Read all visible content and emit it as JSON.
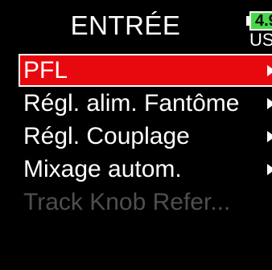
{
  "header": {
    "title": "ENTRÉE",
    "battery": {
      "level": "4.9",
      "source": "USB",
      "color": "#49d64b"
    }
  },
  "menu": {
    "items": [
      {
        "label": "PFL",
        "selected": true,
        "enabled": true,
        "icon": "chevron-right-icon"
      },
      {
        "label": "Régl. alim. Fantôme",
        "selected": false,
        "enabled": true,
        "icon": "chevron-right-icon"
      },
      {
        "label": "Régl. Couplage",
        "selected": false,
        "enabled": true,
        "icon": "chevron-right-icon"
      },
      {
        "label": "Mixage autom.",
        "selected": false,
        "enabled": true,
        "icon": "chevron-right-icon"
      },
      {
        "label": "Track Knob   Refer...",
        "selected": false,
        "enabled": false
      }
    ]
  },
  "colors": {
    "background": "#000000",
    "selection": "#e8090f",
    "text": "#ffffff",
    "disabled_text": "#4e4e4e"
  }
}
